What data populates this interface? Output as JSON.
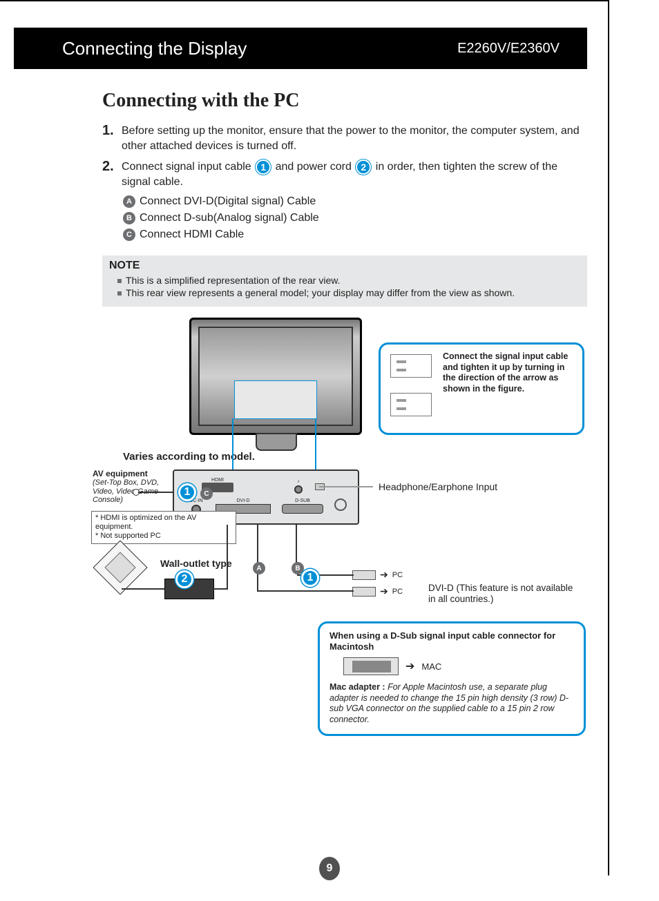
{
  "header": {
    "left": "Connecting the Display",
    "right": "E2260V/E2360V"
  },
  "title": "Connecting with the PC",
  "steps": {
    "s1_num": "1.",
    "s1": "Before setting up the monitor, ensure that the power to the monitor, the computer system, and other attached devices is turned off.",
    "s2_num": "2.",
    "s2a": "Connect signal input cable ",
    "s2_badge1": "1",
    "s2b": " and power cord ",
    "s2_badge2": "2",
    "s2c": " in order, then tighten the screw of the signal cable."
  },
  "sub": {
    "a_letter": "A",
    "a": "Connect DVI-D(Digital signal) Cable",
    "b_letter": "B",
    "b": "Connect D-sub(Analog signal) Cable",
    "c_letter": "C",
    "c": "Connect HDMI Cable"
  },
  "note": {
    "title": "NOTE",
    "l1": "This is a simplified representation of the rear view.",
    "l2": "This rear view represents a general model; your display may differ from the view as shown."
  },
  "diagram": {
    "varies": "Varies according to model.",
    "av_title": "AV equipment",
    "av_sub": "(Set-Top Box, DVD, Video,\nVideo Game Console)",
    "hdmi_note1": "* HDMI is optimized on the AV equipment.",
    "hdmi_note2": "* Not supported PC",
    "wall_label": "Wall-outlet type",
    "hp_label": "Headphone/Earphone Input",
    "hint_text": "Connect the signal input cable and tighten it up by turning in the direction of the arrow as shown in the figure.",
    "pc_label": "PC",
    "dvi_note": "DVI-D (This feature is not available in all countries.)",
    "badge1": "1",
    "badge2": "2",
    "badgeA": "A",
    "badgeB": "B",
    "badgeC": "C",
    "ports": {
      "hdmi": "HDMI",
      "dcin": "DC-IN",
      "dvid": "DVI-D",
      "dsub": "D-SUB",
      "hp": "♪"
    }
  },
  "mac": {
    "heading": "When using a D-Sub signal input cable connector for Macintosh",
    "mac_label": "MAC",
    "body_bold": "Mac adapter : ",
    "body_ital": "For Apple Macintosh use, a  separate plug adapter is needed to change the 15 pin high density (3 row) D-sub VGA connector on the supplied cable to a 15 pin  2 row connector."
  },
  "page_number": "9"
}
